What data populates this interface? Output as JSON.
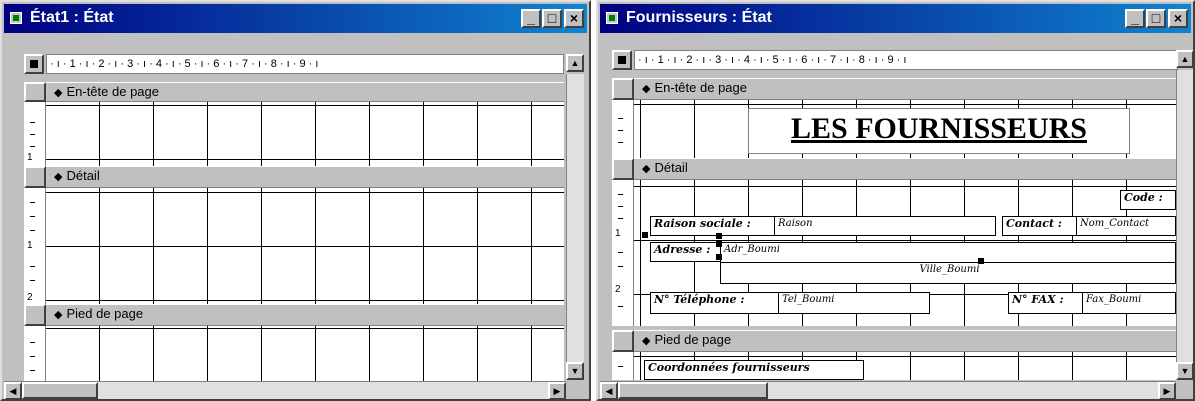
{
  "left_window": {
    "title": "État1 : État",
    "ruler_labels": [
      "1",
      "2",
      "3",
      "4",
      "5",
      "6",
      "7",
      "8",
      "9"
    ],
    "vruler_labels": [
      "1",
      "1",
      "2"
    ],
    "sections": {
      "header": "En-tête de page",
      "detail": "Détail",
      "footer": "Pied de page"
    },
    "buttons": {
      "minimize": "_",
      "maximize": "□",
      "close": "×"
    }
  },
  "right_window": {
    "title": "Fournisseurs : État",
    "ruler_labels": [
      "1",
      "2",
      "3",
      "4",
      "5",
      "6",
      "7",
      "8",
      "9"
    ],
    "vruler_labels": [
      "1",
      "2"
    ],
    "sections": {
      "header": "En-tête de page",
      "detail": "Détail",
      "footer": "Pied de page"
    },
    "report_title": "LES FOURNISSEURS",
    "controls": {
      "code_label": "Code :",
      "raison_label": "Raison sociale :",
      "raison_field": "Raison",
      "contact_label": "Contact :",
      "contact_field": "Nom_Contact",
      "adresse_label": "Adresse :",
      "adresse_field": "Adr_Boumi",
      "ville_field": "Ville_Boumi",
      "tel_label": "N° Téléphone :",
      "tel_field": "Tel_Boumi",
      "fax_label": "N° FAX :",
      "fax_field": "Fax_Boumi",
      "footer_label": "Coordonnées fournisseurs"
    },
    "buttons": {
      "minimize": "_",
      "maximize": "□",
      "close": "×"
    }
  }
}
